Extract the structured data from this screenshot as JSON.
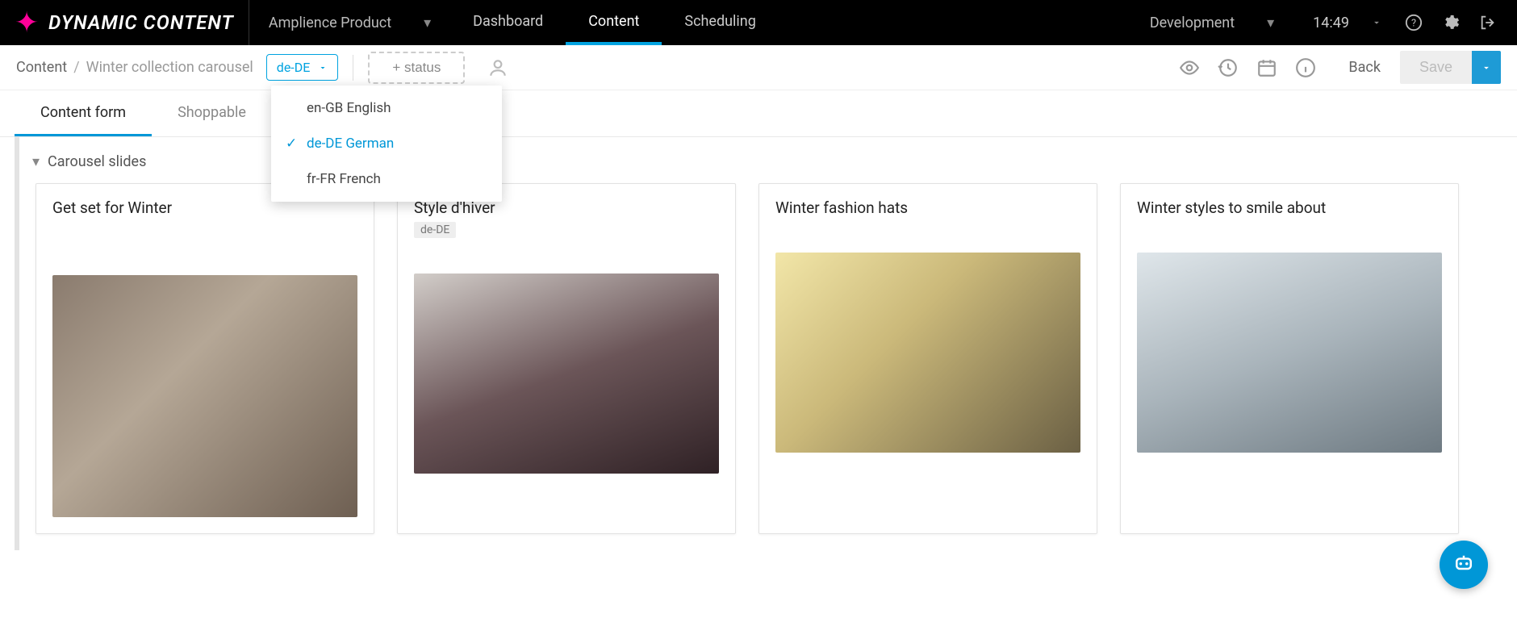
{
  "brand": "DYNAMIC CONTENT",
  "hub_name": "Amplience Product",
  "nav": {
    "dashboard": "Dashboard",
    "content": "Content",
    "scheduling": "Scheduling",
    "development": "Development"
  },
  "time": "14:49",
  "breadcrumb": {
    "root": "Content",
    "current": "Winter collection carousel"
  },
  "locale": {
    "current": "de-DE",
    "options": [
      {
        "code": "en-GB",
        "label": "en-GB English",
        "selected": false
      },
      {
        "code": "de-DE",
        "label": "de-DE German",
        "selected": true
      },
      {
        "code": "fr-FR",
        "label": "fr-FR French",
        "selected": false
      }
    ]
  },
  "toolbar": {
    "add_status": "+ status",
    "back": "Back",
    "save": "Save"
  },
  "tabs": {
    "form": "Content form",
    "shoppable": "Shoppable"
  },
  "section": {
    "title": "Carousel slides"
  },
  "cards": [
    {
      "title": "Get set for Winter",
      "badge": ""
    },
    {
      "title": "Style d'hiver",
      "badge": "de-DE"
    },
    {
      "title": "Winter fashion hats",
      "badge": ""
    },
    {
      "title": "Winter styles to smile about",
      "badge": ""
    }
  ]
}
